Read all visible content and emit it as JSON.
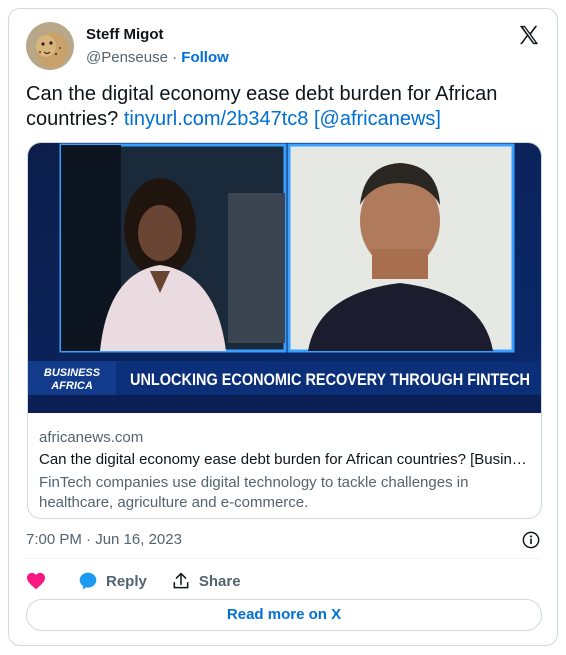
{
  "author": {
    "name": "Steff Migot",
    "handle": "@Penseuse",
    "separator": "·",
    "follow_label": "Follow"
  },
  "tweet": {
    "text": "Can the digital economy ease debt burden for African countries?",
    "link": "tinyurl.com/2b347tc8",
    "mention_open": "[",
    "mention": "@africanews",
    "mention_close": "]"
  },
  "media": {
    "logo_line1": "BUSINESS",
    "logo_line2": "AFRICA",
    "banner": "UNLOCKING ECONOMIC RECOVERY THROUGH FINTECH",
    "domain": "africanews.com",
    "title": "Can the digital economy ease debt burden for African countries? [Business Africa]",
    "description": "FinTech companies use digital technology to tackle challenges in healthcare, agriculture and e-commerce."
  },
  "timestamp": "7:00 PM · Jun 16, 2023",
  "actions": {
    "like_label": "",
    "reply_label": "Reply",
    "share_label": "Share"
  },
  "read_more": "Read more on X",
  "colors": {
    "link": "#006fd6",
    "like": "#f91880",
    "reply": "#1d9bf0"
  }
}
